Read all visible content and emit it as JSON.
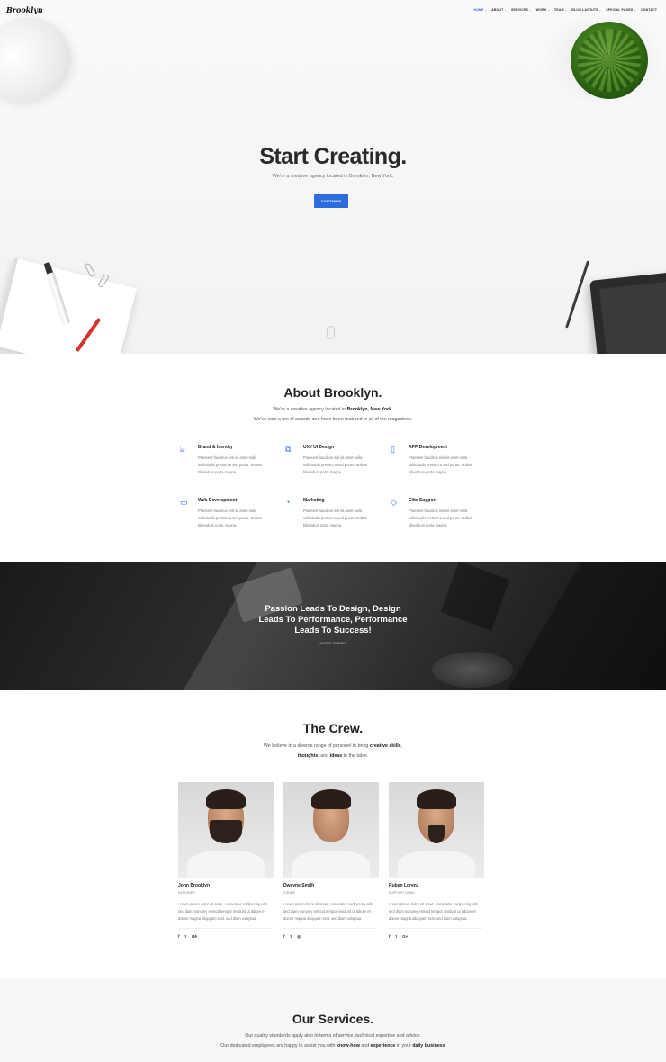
{
  "brand": {
    "logo_text": "Brooklyn",
    "accent": "#2d6cdf"
  },
  "nav": {
    "items": [
      {
        "label": "HOME",
        "active": true,
        "caret": true
      },
      {
        "label": "ABOUT",
        "active": false,
        "caret": true
      },
      {
        "label": "SERVICES",
        "active": false,
        "caret": true
      },
      {
        "label": "WORK",
        "active": false,
        "caret": true
      },
      {
        "label": "TEAM",
        "active": false,
        "caret": true
      },
      {
        "label": "BLOG LAYOUTS",
        "active": false,
        "caret": true
      },
      {
        "label": "SPECIAL PAGES",
        "active": false,
        "caret": true
      },
      {
        "label": "CONTACT",
        "active": false,
        "caret": false
      }
    ]
  },
  "hero": {
    "title": "Start Creating.",
    "subtitle": "We're a creative agency located in Brooklyn, New York.",
    "button": "CONTINUE"
  },
  "about": {
    "title": "About Brooklyn.",
    "line1_prefix": "We're a creative agency located in ",
    "line1_bold": "Brooklyn, New York.",
    "line2": "We've won a ton of awards and have been featured in all of the magazines.",
    "features": [
      {
        "icon": "briefcase-icon",
        "glyph": "⌸",
        "title": "Brand & Identity",
        "desc": "Praesent faucibus nisl sit amet nulla sollicitudin pretium a sed purus. Nullam bibendum porta magna."
      },
      {
        "icon": "devices-icon",
        "glyph": "⧉",
        "title": "UX / UI Design",
        "desc": "Praesent faucibus nisl sit amet nulla sollicitudin pretium a sed purus. Nullam bibendum porta magna."
      },
      {
        "icon": "mobile-icon",
        "glyph": "▯",
        "title": "APP Development",
        "desc": "Praesent faucibus nisl sit amet nulla sollicitudin pretium a sed purus. Nullam bibendum porta magna."
      },
      {
        "icon": "monitor-icon",
        "glyph": "▭",
        "title": "Web Development",
        "desc": "Praesent faucibus nisl sit amet nulla sollicitudin pretium a sed purus. Nullam bibendum porta magna."
      },
      {
        "icon": "pie-chart-icon",
        "glyph": "◔",
        "title": "Marketing",
        "desc": "Praesent faucibus nisl sit amet nulla sollicitudin pretium a sed purus. Nullam bibendum porta magna."
      },
      {
        "icon": "diamond-icon",
        "glyph": "◇",
        "title": "Elite Support",
        "desc": "Praesent faucibus nisl sit amet nulla sollicitudin pretium a sed purus. Nullam bibendum porta magna."
      }
    ]
  },
  "banner": {
    "quote_line1": "Passion Leads To Design, Design",
    "quote_line2": "Leads To Performance, Performance",
    "quote_line3": "Leads To Success!",
    "author": "UNITED THEMES"
  },
  "crew": {
    "title": "The Crew.",
    "line1_prefix": "We believe in a diverse range of personel to bring ",
    "line1_bold": "creative skills",
    "line1_suffix": ",",
    "line2_bold1": "thoughts",
    "line2_mid": ", and ",
    "line2_bold2": "ideas",
    "line2_suffix": " to the table.",
    "members": [
      {
        "name": "John Brooklyn",
        "role": "DESIGNER",
        "desc": "Lorem ipsum dolor sit amet, consetetur sadipscing elitr, sed diam nonumy eirmod tempor invidunt ut labore et dolore magna aliquyam erat, sed diam voluptua.",
        "socials": [
          "f",
          "t",
          "Bē"
        ]
      },
      {
        "name": "Dwayne Smith",
        "role": "CODER",
        "desc": "Lorem ipsum dolor sit amet, consetetur sadipscing elitr, sed diam nonumy eirmod tempor invidunt ut labore et dolore magna aliquyam erat, sed diam voluptua.",
        "socials": [
          "f",
          "t",
          "◎"
        ]
      },
      {
        "name": "Ruben Lorenz",
        "role": "SUPPORT GURU",
        "desc": "Lorem ipsum dolor sit amet, consetetur sadipscing elitr, sed diam nonumy eirmod tempor invidunt ut labore et dolore magna aliquyam erat, sed diam voluptua.",
        "socials": [
          "f",
          "t",
          "G+"
        ]
      }
    ]
  },
  "services": {
    "title": "Our Services.",
    "line1": "Our quality standards apply also in terms of service, technical expertise and advice.",
    "line2_prefix": "Our dedicated employees are happy to assist you with ",
    "line2_bold1": "know-how",
    "line2_mid": " and ",
    "line2_bold2": "experience",
    "line2_mid2": " in your ",
    "line2_bold3": "daily business"
  }
}
